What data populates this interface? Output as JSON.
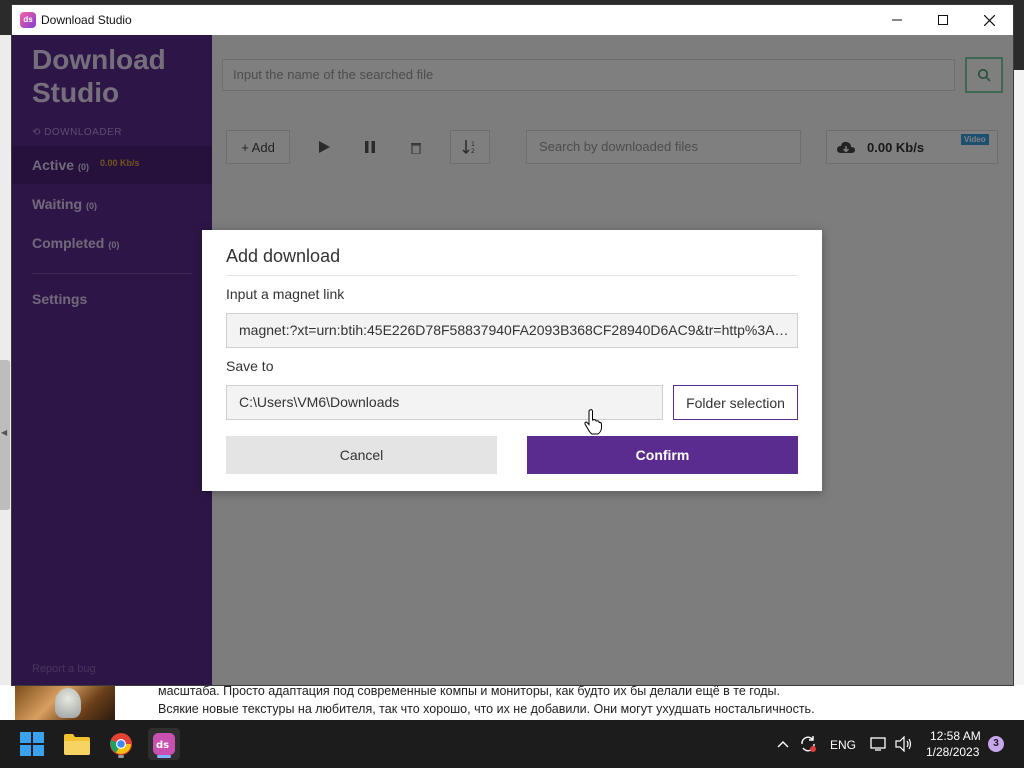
{
  "window": {
    "title": "Download Studio"
  },
  "sidebar": {
    "brand_line1": "Download",
    "brand_line2": "Studio",
    "section_label": "DOWNLOADER",
    "items": [
      {
        "label": "Active",
        "count": "(0)",
        "speed": "0.00 Kb/s"
      },
      {
        "label": "Waiting",
        "count": "(0)"
      },
      {
        "label": "Completed",
        "count": "(0)"
      },
      {
        "label": "Settings"
      }
    ],
    "report_bug": "Report a bug"
  },
  "main": {
    "file_search_placeholder": "Input the name of the searched file",
    "add_label": "+ Add",
    "downloads_search_placeholder": "Search by downloaded files",
    "speed_value": "0.00 Kb/s",
    "speed_tag": "Video"
  },
  "dialog": {
    "title": "Add download",
    "magnet_label": "Input a magnet link",
    "magnet_value": "magnet:?xt=urn:btih:45E226D78F58837940FA2093B368CF28940D6AC9&tr=http%3A%...",
    "save_to_label": "Save to",
    "save_to_value": "C:\\Users\\VM6\\Downloads",
    "folder_button": "Folder selection",
    "cancel_button": "Cancel",
    "confirm_button": "Confirm"
  },
  "background": {
    "line1": "масштаба. Просто адаптация под современные компы и мониторы, как будто их бы делали ещё в те годы.",
    "line2": "Всякие новые текстуры на любителя, так что хорошо, что их не добавили. Они могут ухудшать ностальгичность."
  },
  "taskbar": {
    "language": "ENG",
    "time": "12:58 AM",
    "date": "1/28/2023",
    "notifications": "3"
  },
  "colors": {
    "accent_purple": "#5b2c8f",
    "sidebar_active": "#4b2279",
    "search_green": "#7fd0a0"
  }
}
